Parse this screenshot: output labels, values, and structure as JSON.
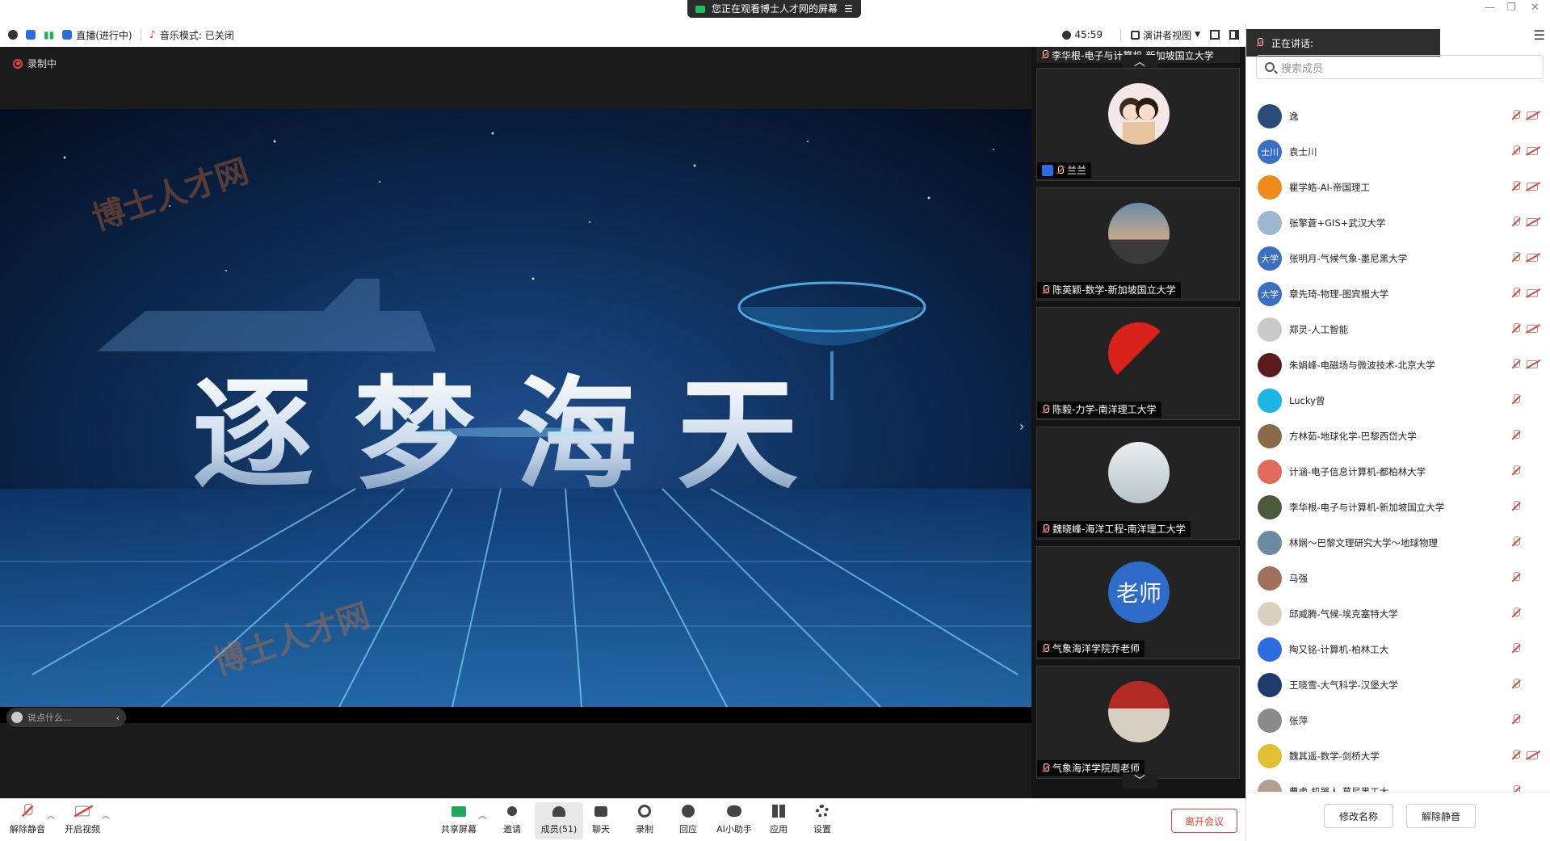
{
  "window": {
    "share_banner": "您正在观看博士人才网的屏幕",
    "share_banner_menu": "☰",
    "controls": [
      "—",
      "❐",
      "✕"
    ]
  },
  "statusbar": {
    "live": "直播(进行中)",
    "music_mode": "音乐模式: 已关闭",
    "timer": "45:59",
    "view_mode": "演讲者视图"
  },
  "stage": {
    "recording": "录制中",
    "video_title": "逐梦海天",
    "chat_placeholder": "说点什么..."
  },
  "thumbnails": {
    "top_partial": "李华根-电子与计算机-新加坡国立大学",
    "tiles": [
      {
        "name": "兰兰",
        "avatar": "cartoon-couple"
      },
      {
        "name": "陈英颖-数学-新加坡国立大学",
        "avatar": "sunset-hill"
      },
      {
        "name": "陈毅-力学-南洋理工大学",
        "avatar": "flag-photo"
      },
      {
        "name": "魏晓峰-海洋工程-南洋理工大学",
        "avatar": "road-photo"
      },
      {
        "name": "气象海洋学院乔老师",
        "avatar_text": "老师"
      },
      {
        "name": "气象海洋学院周老师",
        "avatar": "banner-photo"
      }
    ]
  },
  "panel": {
    "speaking_label": "正在讲话:",
    "search_placeholder": "搜索成员",
    "menu_icon": "☰",
    "members": [
      {
        "name": "逸",
        "avatar_color": "#2a4a7a",
        "avatar_text": "",
        "cam_off": true
      },
      {
        "name": "袁士川",
        "avatar_color": "#3b6fc4",
        "avatar_text": "士川",
        "cam_off": true
      },
      {
        "name": "瞿学皓-AI-帝国理工",
        "avatar_color": "#f08a1c",
        "avatar_text": "",
        "cam_off": true
      },
      {
        "name": "张擎蒼+GIS+武汉大学",
        "avatar_color": "#9bb7d4",
        "avatar_text": "",
        "cam_off": true
      },
      {
        "name": "张明月-气候气象-墨尼黑大学",
        "avatar_color": "#3b6fc4",
        "avatar_text": "大学",
        "cam_off": true
      },
      {
        "name": "章先琦-物理-图宾根大学",
        "avatar_color": "#3b6fc4",
        "avatar_text": "大学",
        "cam_off": true
      },
      {
        "name": "郑灵-人工智能",
        "avatar_color": "#c9c9c9",
        "avatar_text": "",
        "cam_off": true
      },
      {
        "name": "朱娟峰-电磁场与微波技术-北京大学",
        "avatar_color": "#5a1a1a",
        "avatar_text": "",
        "cam_off": true
      },
      {
        "name": "Lucky曾",
        "avatar_color": "#1bb5e8",
        "avatar_text": "",
        "cam_off": false
      },
      {
        "name": "方林茹-地球化学-巴黎西岱大学",
        "avatar_color": "#8a6a4a",
        "avatar_text": "",
        "cam_off": false
      },
      {
        "name": "计涵-电子信息计算机-都柏林大学",
        "avatar_color": "#e26a5a",
        "avatar_text": "",
        "cam_off": false
      },
      {
        "name": "李华根-电子与计算机-新加坡国立大学",
        "avatar_color": "#4a5a3a",
        "avatar_text": "",
        "cam_off": false
      },
      {
        "name": "林娴～巴黎文理研究大学～地球物理",
        "avatar_color": "#6a8aa0",
        "avatar_text": "",
        "cam_off": false
      },
      {
        "name": "马强",
        "avatar_color": "#a0705a",
        "avatar_text": "",
        "cam_off": false
      },
      {
        "name": "邱威腾-气候-埃克塞特大学",
        "avatar_color": "#d9d0c0",
        "avatar_text": "",
        "cam_off": false
      },
      {
        "name": "陶又铭-计算机-柏林工大",
        "avatar_color": "#2c6be0",
        "avatar_text": "",
        "cam_off": false
      },
      {
        "name": "王晓雪-大气科学-汉堡大学",
        "avatar_color": "#1f3a6a",
        "avatar_text": "",
        "cam_off": false
      },
      {
        "name": "张萍",
        "avatar_color": "#8a8a8a",
        "avatar_text": "",
        "cam_off": false
      },
      {
        "name": "魏其遥-数学-剑桥大学",
        "avatar_color": "#e0c030",
        "avatar_text": "",
        "cam_off": true
      },
      {
        "name": "曹虎-机器人-慕尼黑工大",
        "avatar_color": "#b0a090",
        "avatar_text": "",
        "cam_off": false
      }
    ],
    "rename_button": "修改名称",
    "unmute_button": "解除静音"
  },
  "toolbar": {
    "unmute": "解除静音",
    "start_video": "开启视频",
    "share_screen": "共享屏幕",
    "invite": "邀请",
    "members": "成员(51)",
    "chat": "聊天",
    "record": "录制",
    "reactions": "回应",
    "ai_assistant": "AI小助手",
    "apps": "应用",
    "settings": "设置",
    "leave": "离开会议"
  },
  "colors": {
    "accent_red": "#e3463a",
    "stage_bg": "#1b1b1b",
    "avatar_blue": "#3b6fc4"
  }
}
